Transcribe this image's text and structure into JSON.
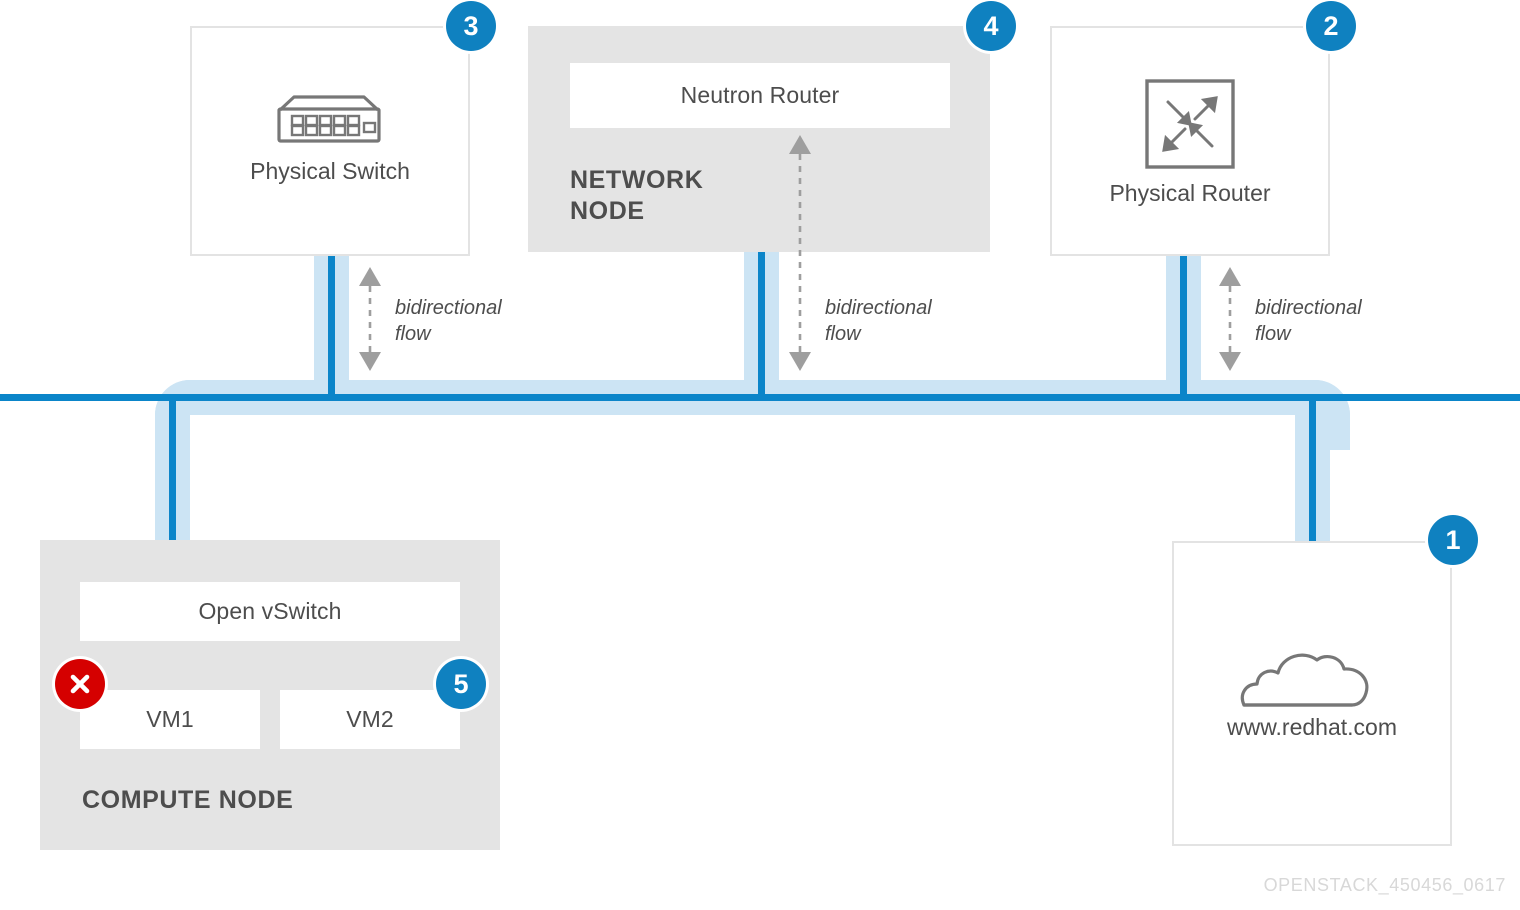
{
  "diagram": {
    "footer_code": "OPENSTACK_450456_0617",
    "colors": {
      "accent_blue": "#0f81c0",
      "pipe_dark": "#0b85c9",
      "pipe_light": "#cce4f4",
      "pipe_light_over_gray": "#b7d5e7",
      "panel_gray": "#e4e4e4",
      "box_border": "#e3e3e3",
      "text_gray": "#4d4d4d",
      "error_red": "#d50000",
      "footer_gray": "#d8d8d8"
    },
    "nodes": {
      "physical_switch": {
        "caption": "Physical Switch",
        "icon": "network-switch-icon",
        "badge": "3"
      },
      "network_node": {
        "title": "NETWORK NODE",
        "badge": "4",
        "inner_card": "Neutron Router"
      },
      "physical_router": {
        "caption": "Physical Router",
        "icon": "router-arrows-icon",
        "badge": "2"
      },
      "compute_node": {
        "title": "COMPUTE NODE",
        "vswitch_card": "Open vSwitch",
        "vm1_card": "VM1",
        "vm2_card": "VM2",
        "vm1_badge_icon": "x-cross-icon",
        "vm2_badge": "5"
      },
      "internet": {
        "caption": "www.redhat.com",
        "icon": "cloud-icon",
        "badge": "1"
      }
    },
    "flow_annotations": [
      {
        "label": "bidirectional flow",
        "line1": "bidirectional",
        "line2": "flow",
        "near": "physical-switch"
      },
      {
        "label": "bidirectional flow",
        "line1": "bidirectional",
        "line2": "flow",
        "near": "network-node"
      },
      {
        "label": "bidirectional flow",
        "line1": "bidirectional",
        "line2": "flow",
        "near": "physical-router"
      }
    ]
  }
}
